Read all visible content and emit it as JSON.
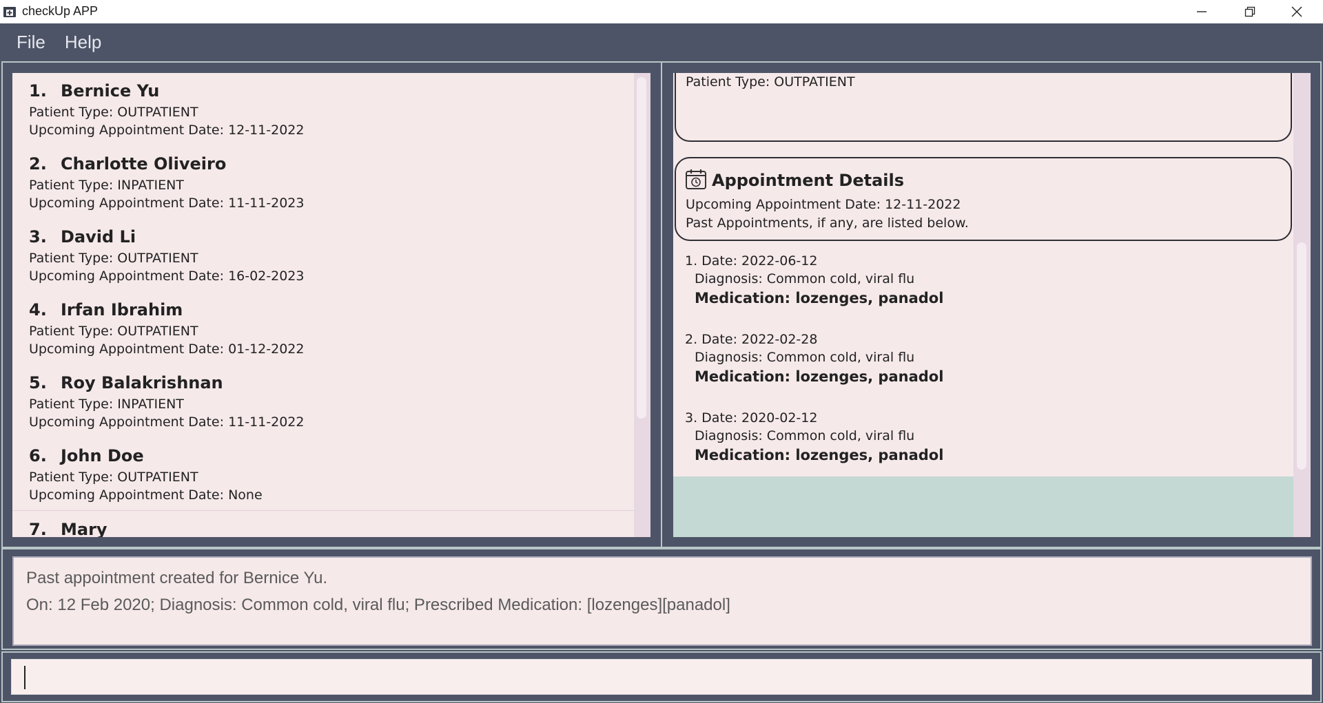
{
  "window": {
    "title": "checkUp APP",
    "controls": [
      "minimize",
      "restore",
      "close"
    ]
  },
  "menu": {
    "items": [
      {
        "label": "File"
      },
      {
        "label": "Help"
      }
    ]
  },
  "patients": [
    {
      "index": "1.",
      "name": "Bernice Yu",
      "type_line": "Patient Type: OUTPATIENT",
      "appt_line": "Upcoming Appointment Date: 12-11-2022"
    },
    {
      "index": "2.",
      "name": "Charlotte Oliveiro",
      "type_line": "Patient Type: INPATIENT",
      "appt_line": "Upcoming Appointment Date: 11-11-2023"
    },
    {
      "index": "3.",
      "name": "David Li",
      "type_line": "Patient Type: OUTPATIENT",
      "appt_line": "Upcoming Appointment Date: 16-02-2023"
    },
    {
      "index": "4.",
      "name": "Irfan Ibrahim",
      "type_line": "Patient Type: OUTPATIENT",
      "appt_line": "Upcoming Appointment Date: 01-12-2022"
    },
    {
      "index": "5.",
      "name": "Roy Balakrishnan",
      "type_line": "Patient Type: INPATIENT",
      "appt_line": "Upcoming Appointment Date: 11-11-2022"
    },
    {
      "index": "6.",
      "name": "John Doe",
      "type_line": "Patient Type: OUTPATIENT",
      "appt_line": "Upcoming Appointment Date: None"
    },
    {
      "index": "7.",
      "name": "Mary",
      "type_line": "",
      "appt_line": ""
    }
  ],
  "detail": {
    "patient_type": "Patient Type: OUTPATIENT",
    "appointment": {
      "title": "Appointment Details",
      "upcoming": "Upcoming Appointment Date: 12-11-2022",
      "note": "Past Appointments, if any, are listed below."
    },
    "past_appointments": [
      {
        "date": "1. Date: 2022-06-12",
        "diagnosis": "Diagnosis: Common cold, viral flu",
        "medication": "Medication: lozenges, panadol"
      },
      {
        "date": "2. Date: 2022-02-28",
        "diagnosis": "Diagnosis: Common cold, viral flu",
        "medication": "Medication: lozenges, panadol"
      },
      {
        "date": "3. Date: 2020-02-12",
        "diagnosis": "Diagnosis: Common cold, viral flu",
        "medication": "Medication: lozenges, panadol"
      }
    ]
  },
  "result": {
    "line1": "Past appointment created for Bernice Yu.",
    "line2": "On: 12 Feb 2020; Diagnosis: Common cold, viral flu; Prescribed Medication: [lozenges][panadol]"
  },
  "command": {
    "value": ""
  },
  "colors": {
    "chrome": "#4e5467",
    "card_bg": "#f6e9ea",
    "accent_teal": "#c4d8d4"
  }
}
